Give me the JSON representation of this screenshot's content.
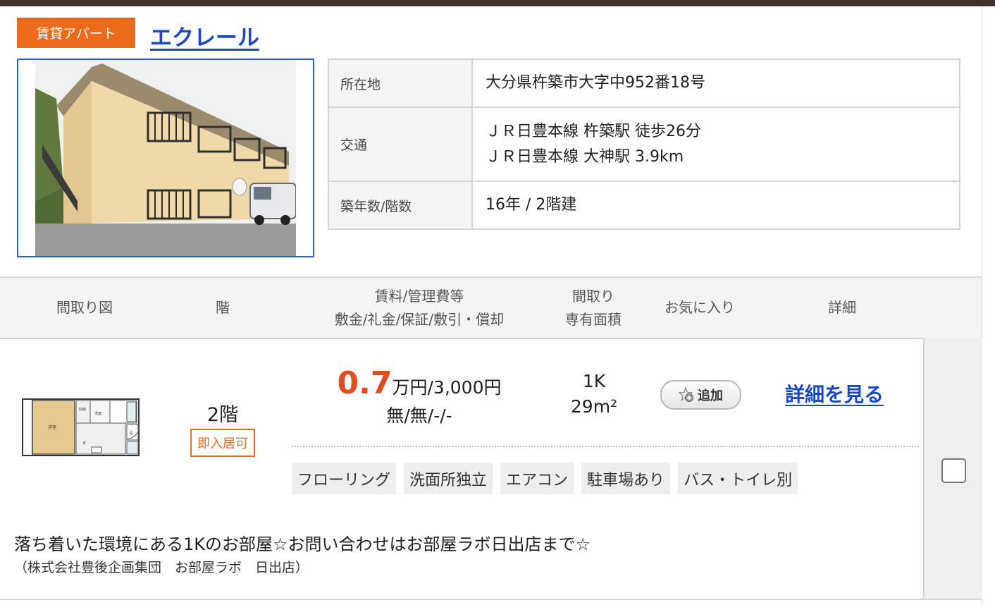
{
  "property": {
    "type_badge": "賃貸アパート",
    "name": "エクレール",
    "info": [
      {
        "label": "所在地",
        "lines": [
          "大分県杵築市大字中952番18号"
        ]
      },
      {
        "label": "交通",
        "lines": [
          "ＪＲ日豊本線 杵築駅 徒歩26分",
          "ＪＲ日豊本線 大神駅 3.9km"
        ]
      },
      {
        "label": "築年数/階数",
        "lines": [
          "16年 / 2階建"
        ]
      }
    ]
  },
  "header": {
    "floorplan": "間取り図",
    "floor": "階",
    "rent_line1": "賃料/管理費等",
    "rent_line2": "敷金/礼金/保証/敷引・償却",
    "layout_line1": "間取り",
    "layout_line2": "専有面積",
    "favorite": "お気に入り",
    "detail": "詳細"
  },
  "unit": {
    "floor": "2階",
    "availability": "即入居可",
    "rent_value": "0.7",
    "rent_unit": "万円",
    "management_fee": "/3,000円",
    "deposit_terms": "無/無/-/-",
    "layout": "1K",
    "area": "29m²",
    "favorite_button": "追加",
    "detail_link": "詳細を見る",
    "tags": [
      "フローリング",
      "洗面所独立",
      "エアコン",
      "駐車場あり",
      "バス・トイレ別"
    ],
    "comment": "落ち着いた環境にある1Kのお部屋☆お問い合わせはお部屋ラボ日出店まで☆",
    "company": "（株式会社豊後企画集団　お部屋ラボ　日出店）",
    "floorplan_labels": {
      "western": "洋室",
      "storage": "収納",
      "wash": "洗面",
      "kitchen": "K",
      "entrance": "玄"
    }
  },
  "colors": {
    "accent_orange": "#ec6a1c",
    "link_blue": "#1a48c8",
    "rent_red": "#e14d1c",
    "top_bar": "#3f3028"
  }
}
